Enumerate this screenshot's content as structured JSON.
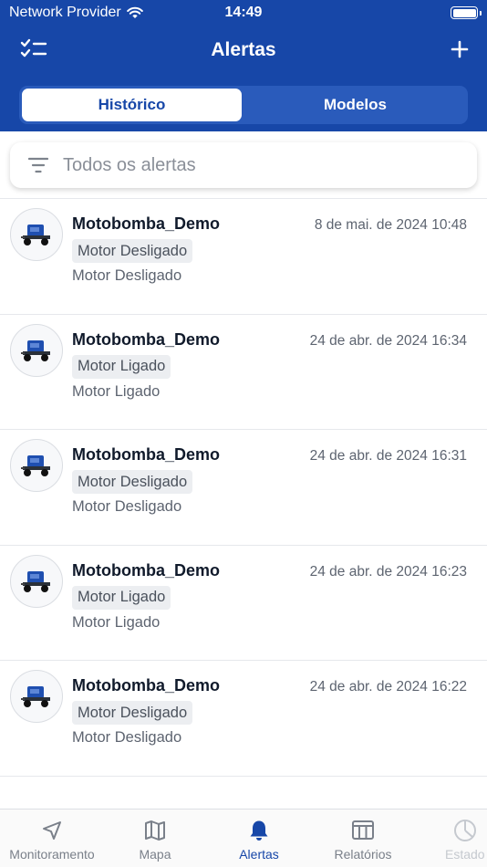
{
  "status_bar": {
    "carrier": "Network Provider",
    "time": "14:49"
  },
  "nav": {
    "title": "Alertas",
    "left_icon": "checklist-icon",
    "right_icon": "plus-icon"
  },
  "segments": {
    "active": "Histórico",
    "inactive": "Modelos"
  },
  "search": {
    "filter_icon": "filter-icon",
    "placeholder": "Todos os alertas"
  },
  "alerts": [
    {
      "device": "Motobomba_Demo",
      "date": "8 de mai. de 2024 10:48",
      "tag": "Motor Desligado",
      "description": "Motor Desligado"
    },
    {
      "device": "Motobomba_Demo",
      "date": "24 de abr. de 2024 16:34",
      "tag": "Motor Ligado",
      "description": "Motor Ligado"
    },
    {
      "device": "Motobomba_Demo",
      "date": "24 de abr. de 2024 16:31",
      "tag": "Motor Desligado",
      "description": "Motor Desligado"
    },
    {
      "device": "Motobomba_Demo",
      "date": "24 de abr. de 2024 16:23",
      "tag": "Motor Ligado",
      "description": "Motor Ligado"
    },
    {
      "device": "Motobomba_Demo",
      "date": "24 de abr. de 2024 16:22",
      "tag": "Motor Desligado",
      "description": "Motor Desligado"
    }
  ],
  "tabbar": {
    "items": [
      {
        "label": "Monitoramento",
        "icon": "navigation-arrow-icon"
      },
      {
        "label": "Mapa",
        "icon": "map-icon"
      },
      {
        "label": "Alertas",
        "icon": "bell-icon",
        "active": true
      },
      {
        "label": "Relatórios",
        "icon": "table-icon"
      },
      {
        "label": "Estado",
        "icon": "pie-chart-icon"
      }
    ]
  },
  "colors": {
    "primary": "#1747a8",
    "segment_bg": "#2a5bbb",
    "tag_bg": "#eceef1"
  }
}
